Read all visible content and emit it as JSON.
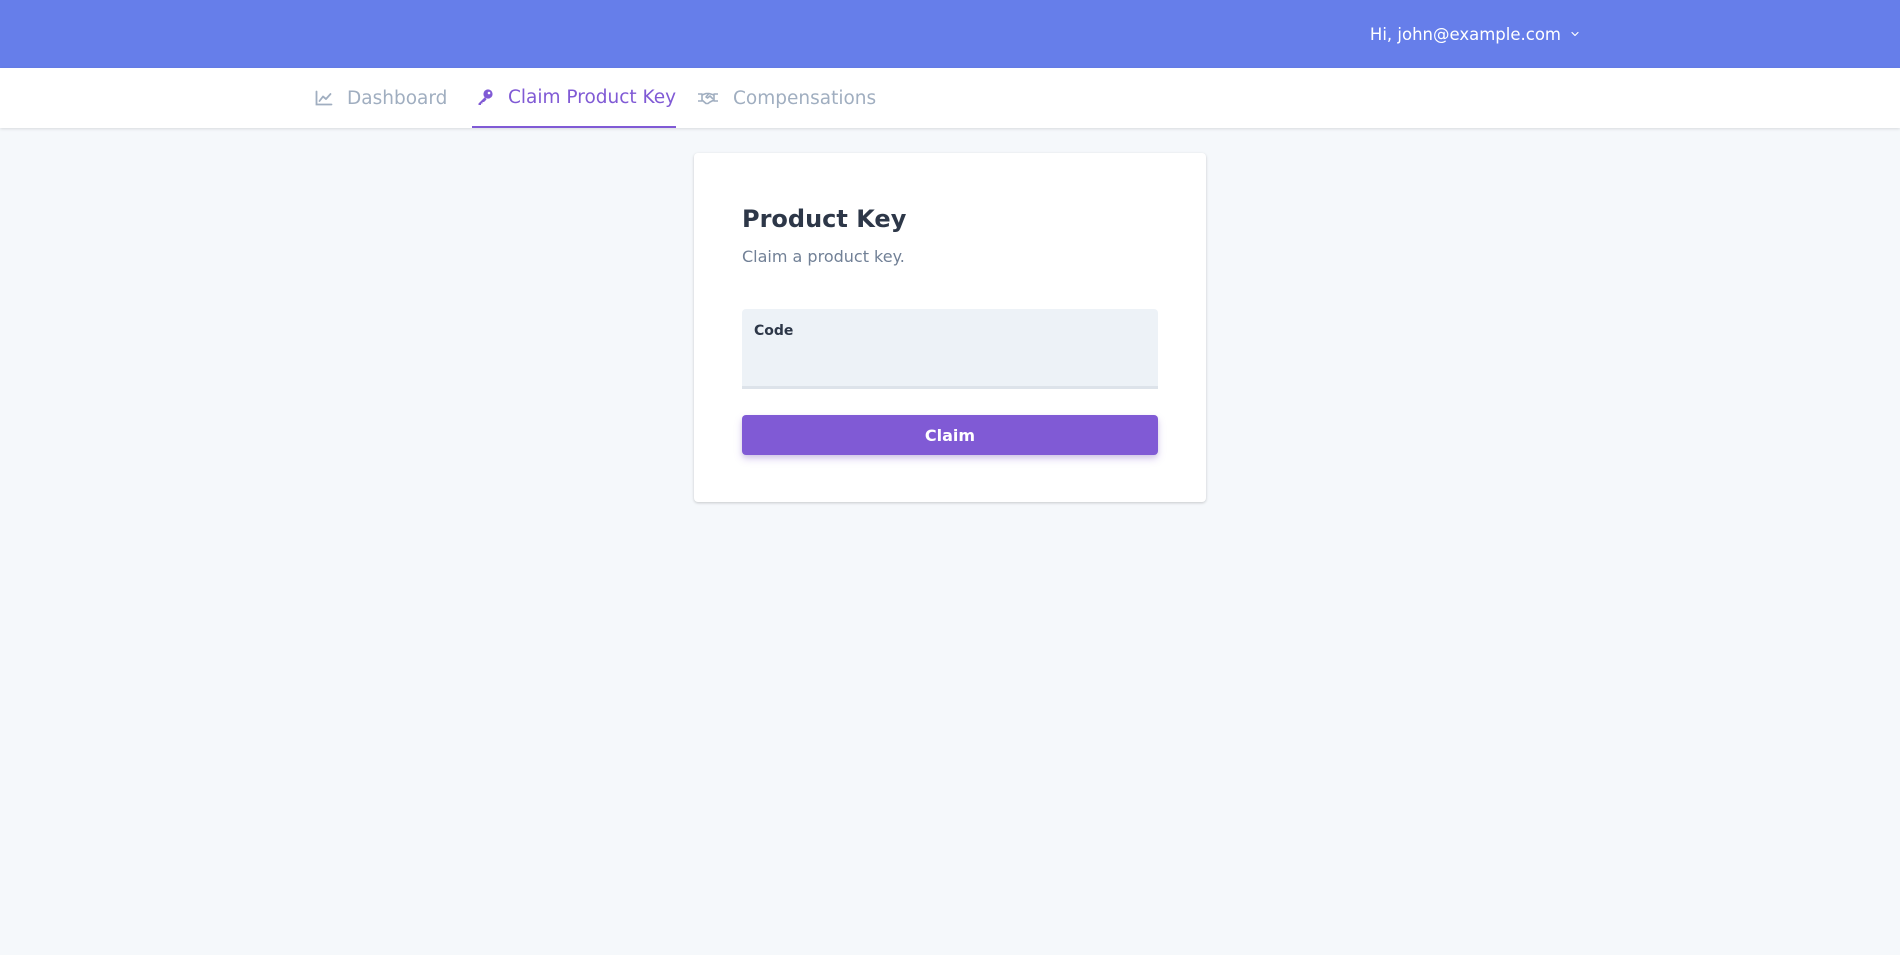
{
  "header": {
    "user_greeting": "Hi, john@example.com",
    "menu_icon": "chevron-down-icon",
    "background_color": "#667eea"
  },
  "nav": {
    "items": [
      {
        "label": "Dashboard",
        "icon": "chart-line-icon",
        "active": false
      },
      {
        "label": "Claim Product Key",
        "icon": "key-icon",
        "active": true
      },
      {
        "label": "Compensations",
        "icon": "handshake-icon",
        "active": false
      }
    ],
    "active_color": "#805ad5",
    "inactive_color": "#a0aec0"
  },
  "card": {
    "title": "Product Key",
    "subtitle": "Claim a product key.",
    "field": {
      "label": "Code",
      "value": ""
    },
    "submit_label": "Claim",
    "button_color": "#805ad5"
  }
}
